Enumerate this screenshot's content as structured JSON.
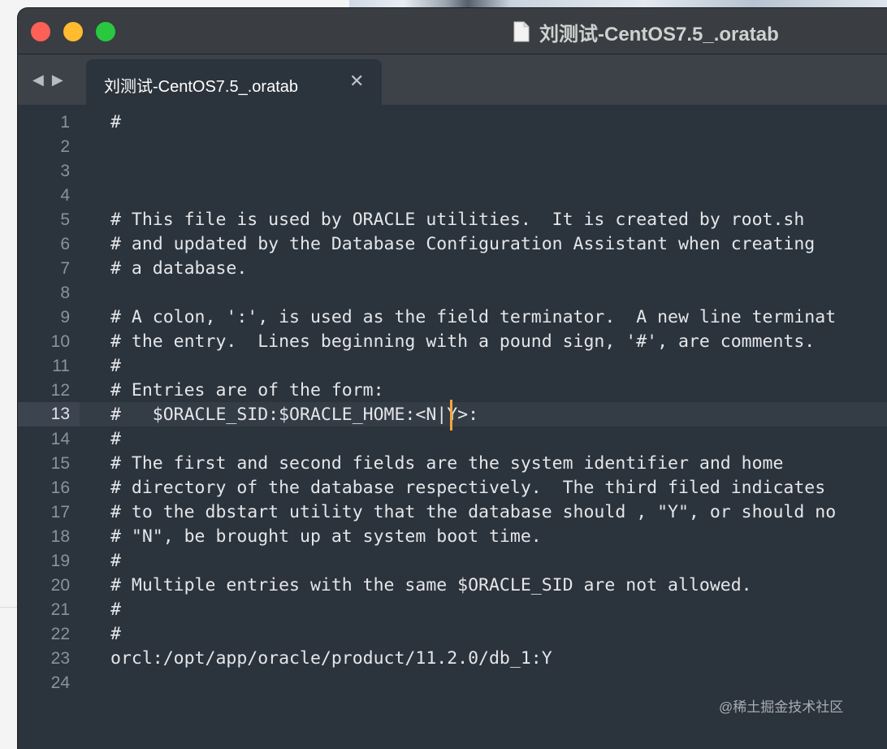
{
  "window": {
    "title": "刘测试-CentOS7.5_.oratab",
    "doc_icon": "document-icon"
  },
  "tab": {
    "label": "刘测试-CentOS7.5_.oratab",
    "close_glyph": "✕",
    "back_glyph": "◀",
    "forward_glyph": "▶"
  },
  "editor": {
    "active_line": 13,
    "lines": [
      {
        "n": "1",
        "text": "#"
      },
      {
        "n": "2",
        "text": ""
      },
      {
        "n": "3",
        "text": ""
      },
      {
        "n": "4",
        "text": ""
      },
      {
        "n": "5",
        "text": "# This file is used by ORACLE utilities.  It is created by root.sh"
      },
      {
        "n": "6",
        "text": "# and updated by the Database Configuration Assistant when creating"
      },
      {
        "n": "7",
        "text": "# a database."
      },
      {
        "n": "8",
        "text": ""
      },
      {
        "n": "9",
        "text": "# A colon, ':', is used as the field terminator.  A new line terminat"
      },
      {
        "n": "10",
        "text": "# the entry.  Lines beginning with a pound sign, '#', are comments."
      },
      {
        "n": "11",
        "text": "#"
      },
      {
        "n": "12",
        "text": "# Entries are of the form:"
      },
      {
        "n": "13",
        "text": "#   $ORACLE_SID:$ORACLE_HOME:<N|Y>:"
      },
      {
        "n": "14",
        "text": "#"
      },
      {
        "n": "15",
        "text": "# The first and second fields are the system identifier and home"
      },
      {
        "n": "16",
        "text": "# directory of the database respectively.  The third filed indicates"
      },
      {
        "n": "17",
        "text": "# to the dbstart utility that the database should , \"Y\", or should no"
      },
      {
        "n": "18",
        "text": "# \"N\", be brought up at system boot time."
      },
      {
        "n": "19",
        "text": "#"
      },
      {
        "n": "20",
        "text": "# Multiple entries with the same $ORACLE_SID are not allowed."
      },
      {
        "n": "21",
        "text": "#"
      },
      {
        "n": "22",
        "text": "#"
      },
      {
        "n": "23",
        "text": "orcl:/opt/app/oracle/product/11.2.0/db_1:Y"
      },
      {
        "n": "24",
        "text": ""
      }
    ]
  },
  "watermark": "@稀土掘金技术社区",
  "colors": {
    "editor_bg": "#2b333c",
    "caret": "#f5a43a",
    "traffic_red": "#fe5f57",
    "traffic_yellow": "#febc2e",
    "traffic_green": "#28c840"
  }
}
